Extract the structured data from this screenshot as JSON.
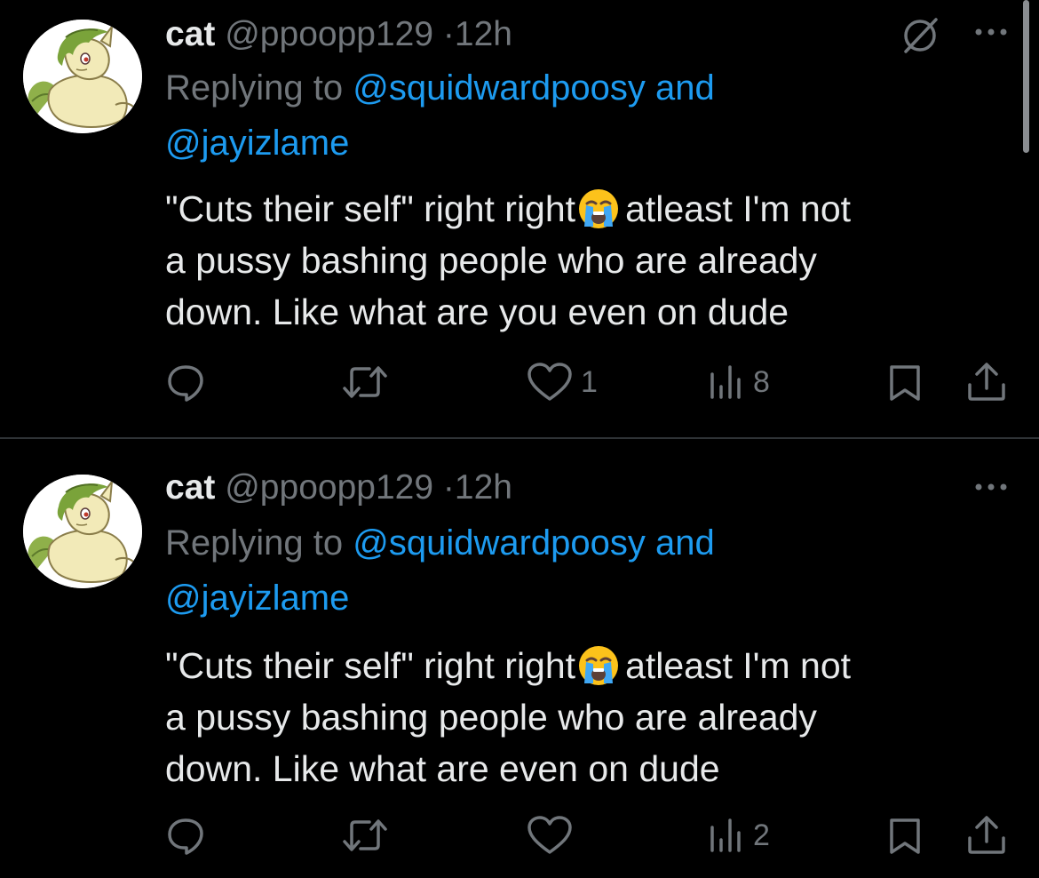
{
  "colors": {
    "background": "#000000",
    "text_primary": "#e7e9ea",
    "text_secondary": "#71767b",
    "link": "#1d9bf0",
    "divider": "#2f3336"
  },
  "tweets": [
    {
      "author": {
        "name": "cat",
        "handle": "@ppoopp129",
        "separator": "·",
        "time": "12h",
        "avatar_icon": "pony-avatar-icon"
      },
      "reply": {
        "prefix": "Replying to",
        "mention_1": "@squidwardpoosy",
        "conjunction": "and",
        "mention_2": "@jayizlame"
      },
      "body": {
        "line_1a": "\"Cuts their self\" right right",
        "emoji": "loudly-crying-face-emoji",
        "line_1b": "atleast I'm not",
        "line_2": "a pussy bashing people who are already",
        "line_3": "down. Like what are you even on dude"
      },
      "top_icons": [
        "grok-icon",
        "more-icon"
      ],
      "actions": {
        "reply_icon": "reply-icon",
        "retweet_icon": "retweet-icon",
        "like_icon": "heart-icon",
        "likes": "1",
        "views_icon": "views-icon",
        "views": "8",
        "bookmark_icon": "bookmark-icon",
        "share_icon": "share-icon"
      }
    },
    {
      "author": {
        "name": "cat",
        "handle": "@ppoopp129",
        "separator": "·",
        "time": "12h",
        "avatar_icon": "pony-avatar-icon"
      },
      "reply": {
        "prefix": "Replying to",
        "mention_1": "@squidwardpoosy",
        "conjunction": "and",
        "mention_2": "@jayizlame"
      },
      "body": {
        "line_1a": "\"Cuts their self\" right right",
        "emoji": "loudly-crying-face-emoji",
        "line_1b": "atleast I'm not",
        "line_2": "a pussy bashing people who are already",
        "line_3": "down. Like what are even on dude"
      },
      "top_icons": [
        "more-icon"
      ],
      "actions": {
        "reply_icon": "reply-icon",
        "retweet_icon": "retweet-icon",
        "like_icon": "heart-icon",
        "likes": "",
        "views_icon": "views-icon",
        "views": "2",
        "bookmark_icon": "bookmark-icon",
        "share_icon": "share-icon"
      }
    }
  ]
}
